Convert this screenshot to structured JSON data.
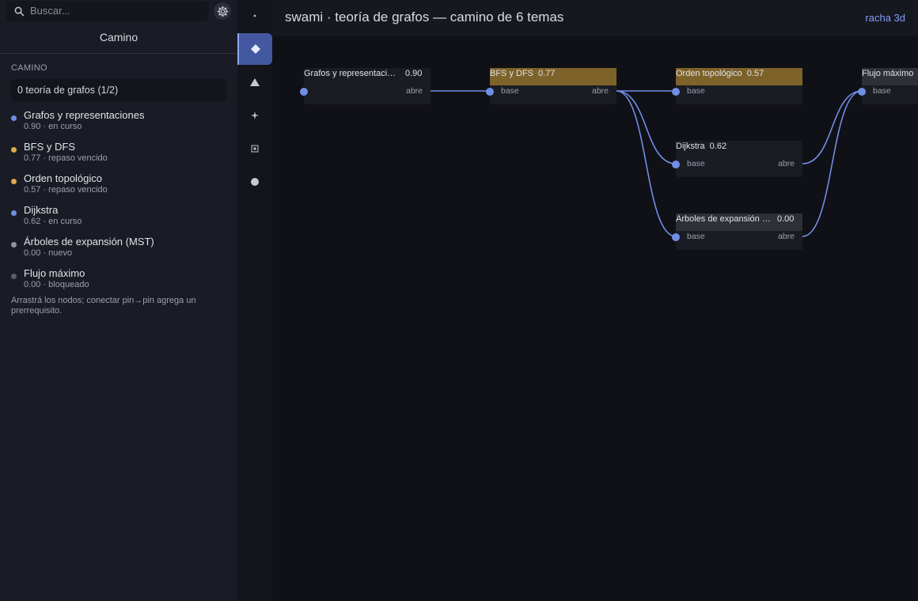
{
  "search": {
    "placeholder": "Buscar..."
  },
  "icons": {
    "search": "search-icon",
    "settings": "gear-icon"
  },
  "sidebar": {
    "title": "Camino",
    "section_label": "CAMINO",
    "path_selector": "0 teoría de grafos (1/2)",
    "topics": [
      {
        "name": "Grafos y representaciones",
        "meta": "0.90 · en curso",
        "color": "#6f8ee6"
      },
      {
        "name": "BFS y DFS",
        "meta": "0.77 · repaso vencido",
        "color": "#e0a94a"
      },
      {
        "name": "Orden topológico",
        "meta": "0.57 · repaso vencido",
        "color": "#e0a94a"
      },
      {
        "name": "Dijkstra",
        "meta": "0.62 · en curso",
        "color": "#6f8ee6"
      },
      {
        "name": "Árboles de expansión (MST)",
        "meta": "0.00 · nuevo",
        "color": "#8f939c"
      },
      {
        "name": "Flujo máximo",
        "meta": "0.00 · bloqueado",
        "color": "#5b5f68"
      }
    ],
    "hint": "Arrastrá los nodos; conectar pin→pin agrega un prerrequisito."
  },
  "rail": {
    "items": [
      "dot-icon",
      "diamond-icon",
      "triangle-icon",
      "sparkle-icon",
      "grid-box-icon",
      "circle-icon"
    ],
    "active": 1
  },
  "header": {
    "title": "swami · teoría de grafos — camino de 6 temas",
    "streak": "racha 3d"
  },
  "graph": {
    "pin_in_label": "base",
    "pin_out_label": "abre",
    "nodes": [
      {
        "id": "grafos",
        "title": "Grafos y representaciones",
        "score": "0.90",
        "state": "active",
        "has_in_label": false
      },
      {
        "id": "bfs",
        "title": "BFS y DFS",
        "score": "0.77",
        "state": "due",
        "has_in_label": true
      },
      {
        "id": "topo",
        "title": "Orden topológico",
        "score": "0.57",
        "state": "due",
        "has_in_label": true,
        "has_out": false
      },
      {
        "id": "dijkstra",
        "title": "Dijkstra",
        "score": "0.62",
        "state": "active",
        "has_in_label": true
      },
      {
        "id": "mst",
        "title": "Árboles de expansión (MST)",
        "score": "0.00",
        "state": "new",
        "has_in_label": true
      },
      {
        "id": "flujo",
        "title": "Flujo máximo",
        "score": "",
        "state": "new",
        "has_in_label": true
      }
    ],
    "edges": [
      [
        "grafos",
        "bfs"
      ],
      [
        "bfs",
        "topo"
      ],
      [
        "bfs",
        "dijkstra"
      ],
      [
        "bfs",
        "mst"
      ],
      [
        "dijkstra",
        "flujo"
      ],
      [
        "mst",
        "flujo"
      ]
    ],
    "edge_color": "#6f8ee6"
  }
}
